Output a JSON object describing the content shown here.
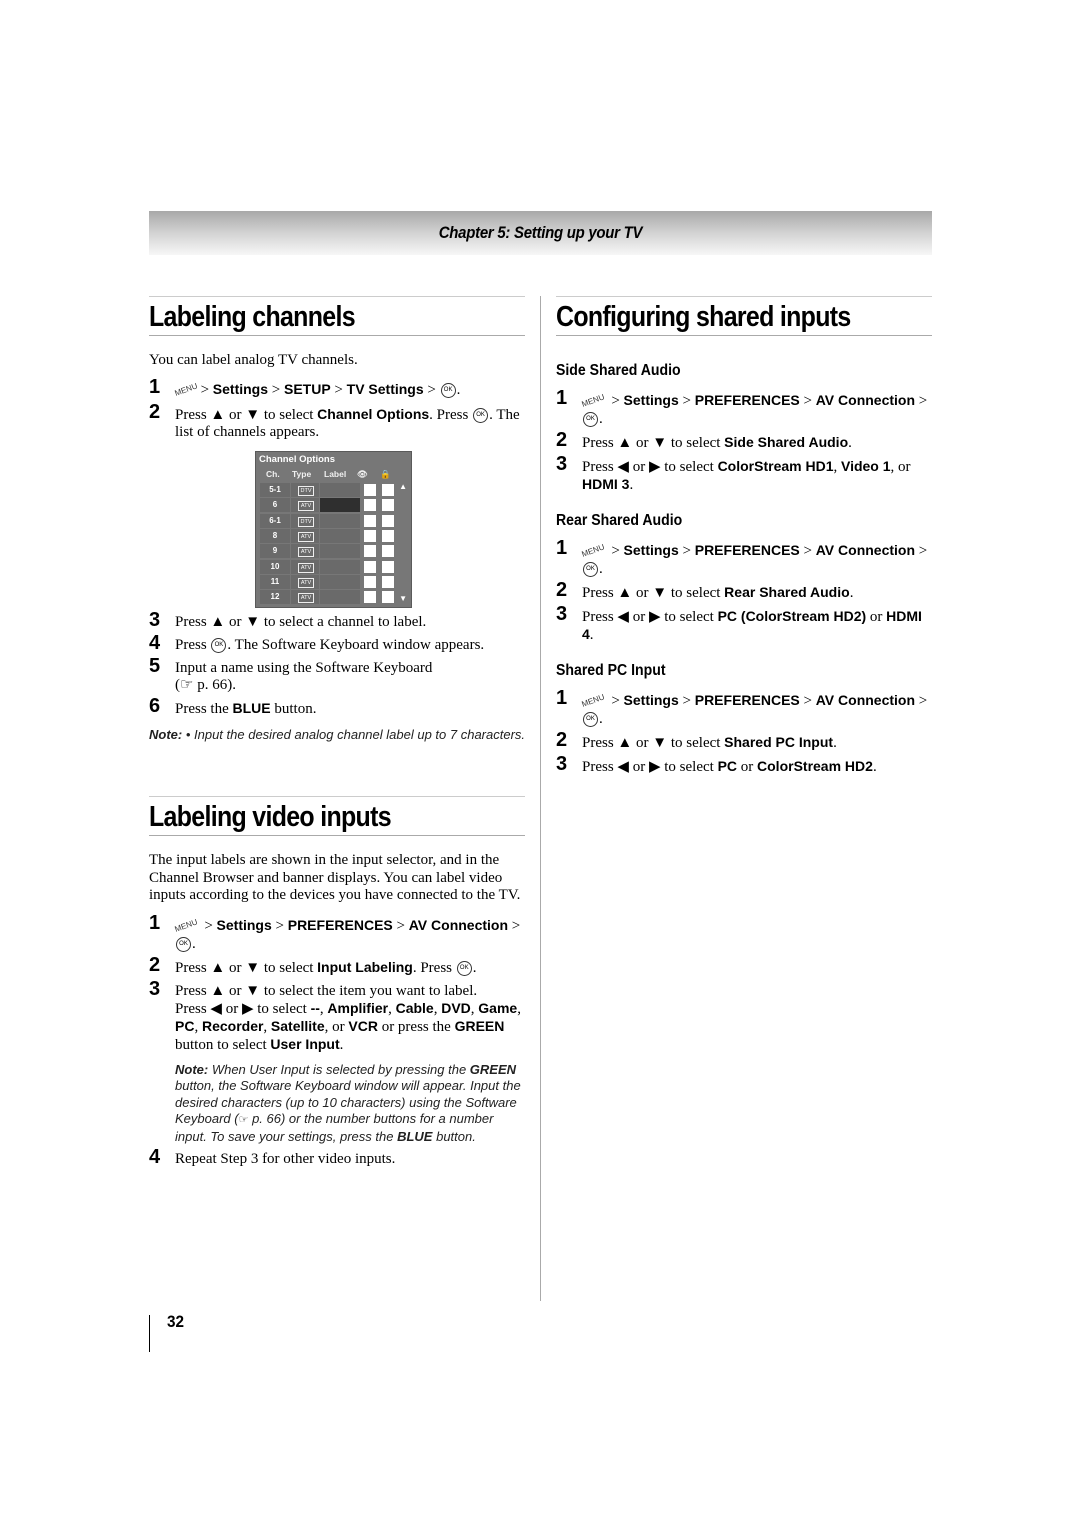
{
  "chapter_header": "Chapter 5: Setting up your TV",
  "left": {
    "labeling_channels": {
      "title": "Labeling channels",
      "intro": "You can label analog TV channels.",
      "steps": [
        {
          "num": "1",
          "menu": "MENU",
          "path": [
            {
              "t": "> ",
              "b": false
            },
            {
              "t": "Settings",
              "b": true
            },
            {
              "t": " > ",
              "b": false
            },
            {
              "t": "SETUP",
              "b": true
            },
            {
              "t": " > ",
              "b": false
            },
            {
              "t": "TV Settings",
              "b": true
            },
            {
              "t": " > ",
              "b": false
            }
          ],
          "ok": "OK",
          "end": "."
        },
        {
          "num": "2",
          "pre": "Press ▲ or ▼ to select ",
          "bold": "Channel Options",
          "post": ". Press ",
          "ok": "OK",
          "end": ". The list of channels appears."
        }
      ],
      "channel_panel": {
        "title": "Channel Options",
        "headers": {
          "ch": "Ch.",
          "type": "Type",
          "label": "Label",
          "skip_icon": "eye-skip-icon",
          "lock_icon": "lock-icon"
        },
        "rows": [
          {
            "ch": "5-1",
            "type": "DTV",
            "selected": false
          },
          {
            "ch": "6",
            "type": "ATV",
            "selected": true
          },
          {
            "ch": "6-1",
            "type": "DTV",
            "selected": false
          },
          {
            "ch": "8",
            "type": "ATV",
            "selected": false
          },
          {
            "ch": "9",
            "type": "ATV",
            "selected": false
          },
          {
            "ch": "10",
            "type": "ATV",
            "selected": false
          },
          {
            "ch": "11",
            "type": "ATV",
            "selected": false
          },
          {
            "ch": "12",
            "type": "ATV",
            "selected": false
          }
        ],
        "scroll_up": "▲",
        "scroll_down": "▼"
      },
      "steps2": [
        {
          "num": "3",
          "text": "Press ▲ or ▼ to select a channel to label."
        },
        {
          "num": "4",
          "pre": "Press ",
          "ok": "OK",
          "text": ". The Software Keyboard window appears."
        },
        {
          "num": "5",
          "text": "Input a name using the Software Keyboard",
          "ref": "☞ p. 66)."
        },
        {
          "num": "6",
          "pre": "Press the ",
          "bold": "BLUE",
          "post": " button."
        }
      ],
      "note_label": "Note:",
      "note": "• Input the desired analog channel label up to 7 characters."
    },
    "labeling_video_inputs": {
      "title": "Labeling video inputs",
      "intro": "The input labels are shown in the input selector, and in the Channel Browser and banner displays. You can label video inputs according to the devices you have connected to the TV.",
      "step1": {
        "num": "1",
        "menu": "MENU",
        "settings": "Settings",
        "prefs": "PREFERENCES",
        "av": "AV Connection",
        "ok": "OK"
      },
      "step2": {
        "num": "2",
        "pre": "Press ▲ or ▼ to select ",
        "bold": "Input Labeling",
        "post": ". Press ",
        "ok": "OK"
      },
      "step3": {
        "num": "3",
        "line1": "Press ▲ or ▼ to select the item you want to label.",
        "pre": "Press ◀ or ▶ to select ",
        "options": [
          "--",
          "Amplifier",
          "Cable",
          "DVD",
          "Game",
          "PC",
          "Recorder",
          "Satellite"
        ],
        "or": ", or ",
        "last": "VCR",
        "post": " or press the ",
        "green": "GREEN",
        "post2": " button to select ",
        "user_input": "User Input"
      },
      "note_label": "Note:",
      "note_a": " When User Input is selected by pressing the ",
      "note_green": "GREEN",
      "note_b": " button, the Software Keyboard window will appear. Input the desired characters (up to 10 characters) using the Software Keyboard (",
      "note_ref": "☞",
      "note_c": " p. 66) or the number buttons for a number input. To save your settings, press the ",
      "note_blue": "BLUE",
      "note_d": " button.",
      "step4": {
        "num": "4",
        "text": "Repeat Step 3 for other video inputs."
      }
    }
  },
  "right": {
    "title": "Configuring shared inputs",
    "sections": [
      {
        "heading": "Side Shared Audio",
        "s2_pre": "Press ▲ or ▼ to select ",
        "s2_bold": "Side Shared Audio",
        "s3_pre": "Press ◀ or ▶ to select ",
        "s3_html": [
          {
            "t": "ColorStream HD1",
            "b": true
          },
          {
            "t": ", ",
            "b": false
          },
          {
            "t": "Video 1",
            "b": true
          },
          {
            "t": ", or ",
            "b": false
          },
          {
            "t": "HDMI 3",
            "b": true
          },
          {
            "t": ".",
            "b": false
          }
        ]
      },
      {
        "heading": "Rear Shared Audio",
        "s2_pre": "Press ▲ or ▼ to select ",
        "s2_bold": "Rear Shared Audio",
        "s3_pre": "Press ◀ or ▶ to select ",
        "s3_html": [
          {
            "t": "PC (ColorStream HD2)",
            "b": true
          },
          {
            "t": " or ",
            "b": false
          },
          {
            "t": "HDMI 4",
            "b": true
          },
          {
            "t": ".",
            "b": false
          }
        ]
      },
      {
        "heading": "Shared PC Input",
        "s2_pre": "Press ▲ or ▼ to select ",
        "s2_bold": "Shared PC Input",
        "s3_pre": "Press ◀ or ▶ to select ",
        "s3_html": [
          {
            "t": "PC",
            "b": true
          },
          {
            "t": " or ",
            "b": false
          },
          {
            "t": "ColorStream HD2",
            "b": true
          },
          {
            "t": ".",
            "b": false
          }
        ]
      }
    ],
    "common_step1": {
      "menu": "MENU",
      "settings": "Settings",
      "prefs": "PREFERENCES",
      "av": "AV Connection",
      "ok": "OK"
    }
  },
  "page_number": "32"
}
